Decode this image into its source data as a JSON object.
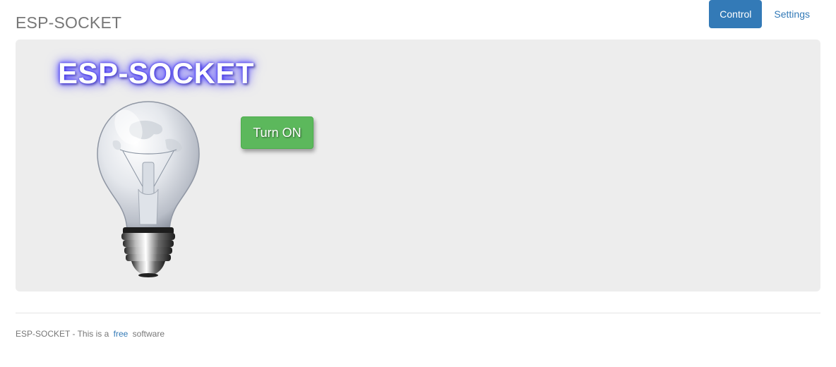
{
  "header": {
    "brand": "ESP-SOCKET",
    "nav": [
      {
        "label": "Control",
        "active": true
      },
      {
        "label": "Settings",
        "active": false
      }
    ]
  },
  "main": {
    "hero_title": "ESP-SOCKET",
    "bulb_icon": "light-bulb-icon",
    "toggle_label": "Turn ON",
    "colors": {
      "panel": "#ededed",
      "button": "#5cb85c",
      "accent": "#337ab7",
      "glow": "#4b3fff"
    }
  },
  "footer": {
    "prefix": "ESP-SOCKET - This is a",
    "link": "free",
    "suffix": "software"
  }
}
